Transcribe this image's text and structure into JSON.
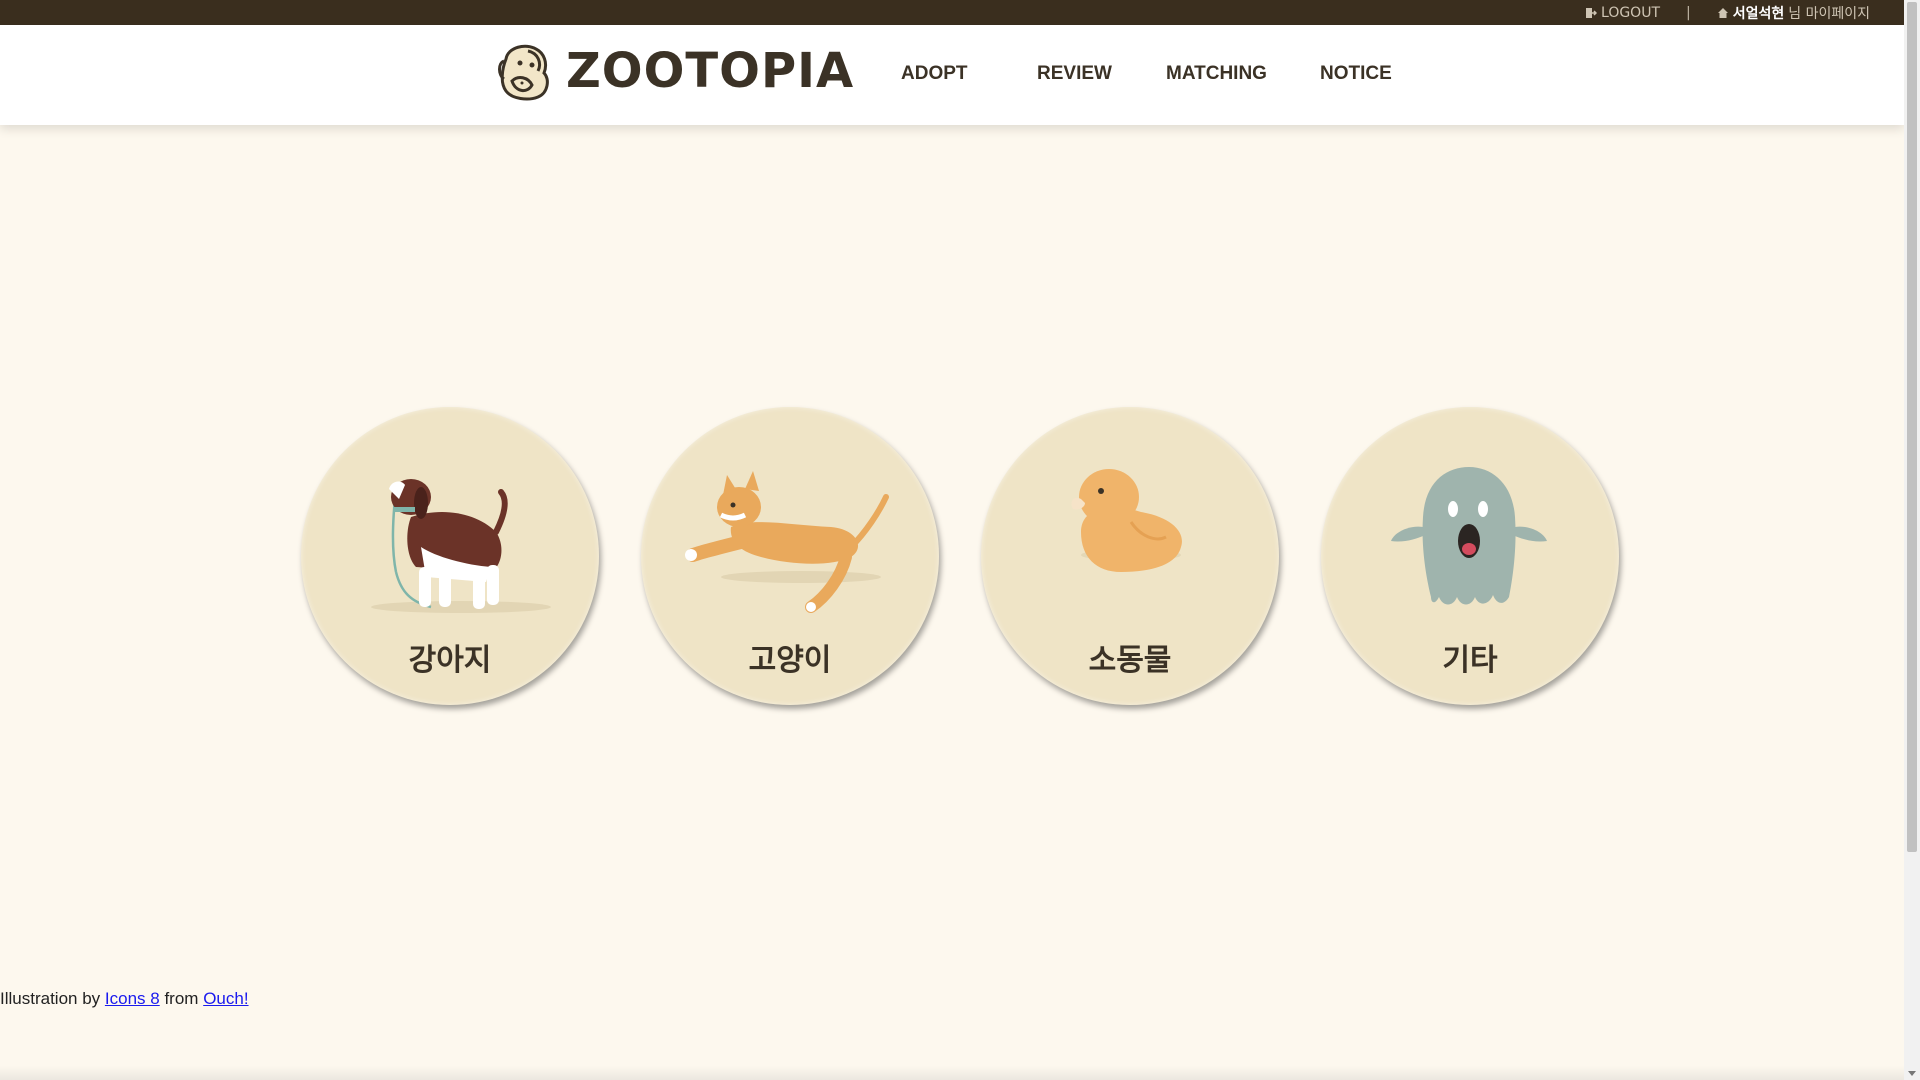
{
  "topbar": {
    "logout_label": "LOGOUT",
    "separator": "|",
    "user_name": "서얼석현",
    "user_suffix": "님 마이페이지"
  },
  "header": {
    "logo_text": "ZOOTOPIA",
    "nav": [
      "ADOPT",
      "REVIEW",
      "MATCHING",
      "NOTICE"
    ]
  },
  "categories": [
    {
      "label": "강아지",
      "icon": "dog-illustration"
    },
    {
      "label": "고양이",
      "icon": "cat-illustration"
    },
    {
      "label": "소동물",
      "icon": "duck-illustration"
    },
    {
      "label": "기타",
      "icon": "ghost-illustration"
    }
  ],
  "credit": {
    "prefix": "Illustration by",
    "link1": "Icons 8",
    "middle": "from",
    "link2": "Ouch!"
  },
  "colors": {
    "page_bg": "#fdf8ee",
    "topbar_bg": "#3a2e1e",
    "circle_bg": "#efe4c6",
    "text_dark": "#3b3226"
  }
}
